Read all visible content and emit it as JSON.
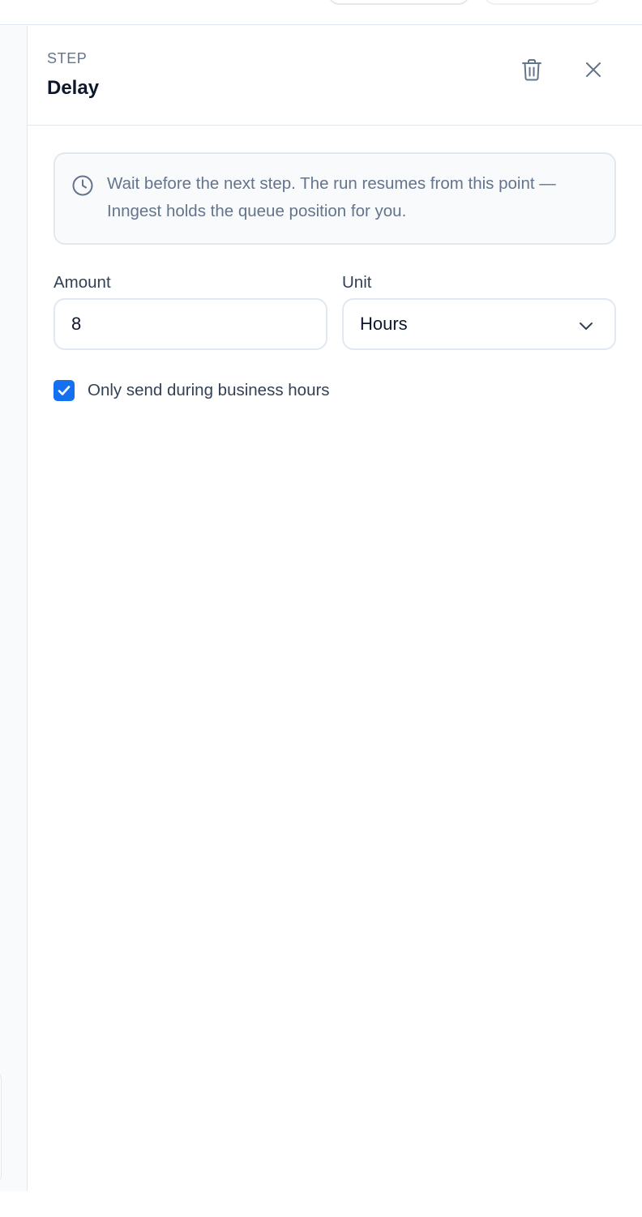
{
  "panel": {
    "eyebrow": "STEP",
    "title": "Delay",
    "actions": [
      {
        "name": "delete",
        "icon": "trash-icon"
      },
      {
        "name": "close",
        "icon": "close-icon"
      }
    ]
  },
  "callout": {
    "icon": "clock-icon",
    "text": "Wait before the next step. The run resumes from this point — Inngest holds the queue position for you."
  },
  "form": {
    "amount": {
      "label": "Amount",
      "value": "8"
    },
    "unit": {
      "label": "Unit",
      "value": "Hours",
      "icon": "chevron-down-icon"
    },
    "business_hours": {
      "label": "Only send during business hours",
      "checked": true
    }
  },
  "colors": {
    "accent": "#1570ef",
    "muted_text": "#64748b",
    "border": "#e2e8f0"
  }
}
